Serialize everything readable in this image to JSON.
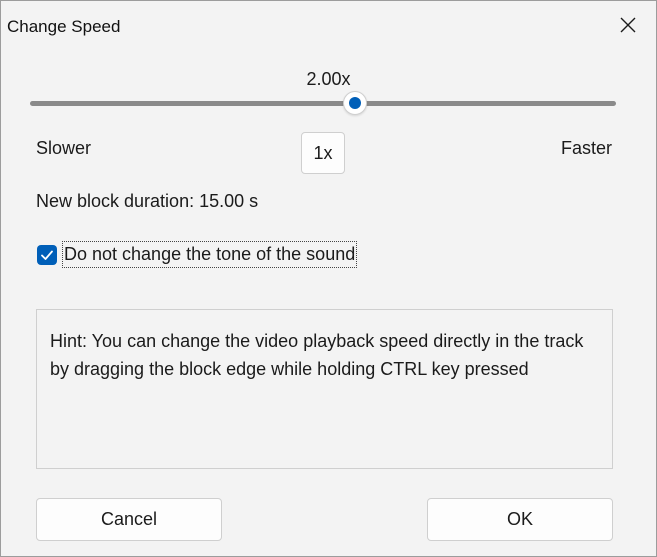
{
  "window": {
    "title": "Change Speed"
  },
  "slider": {
    "value_label": "2.00x",
    "position_fraction": 0.555
  },
  "labels": {
    "slower": "Slower",
    "faster": "Faster"
  },
  "reset_button": {
    "label": "1x"
  },
  "duration": {
    "text": "New block duration: 15.00 s"
  },
  "checkbox": {
    "label": "Do not change the tone of the sound",
    "checked": true
  },
  "hint": {
    "text": "Hint: You can change the video playback speed directly in the track by dragging the block edge while holding CTRL key pressed"
  },
  "buttons": {
    "cancel": "Cancel",
    "ok": "OK"
  },
  "colors": {
    "accent": "#005fb8",
    "background": "#f3f3f3"
  },
  "icons": {
    "close": "close-icon",
    "check": "checkmark-icon"
  }
}
